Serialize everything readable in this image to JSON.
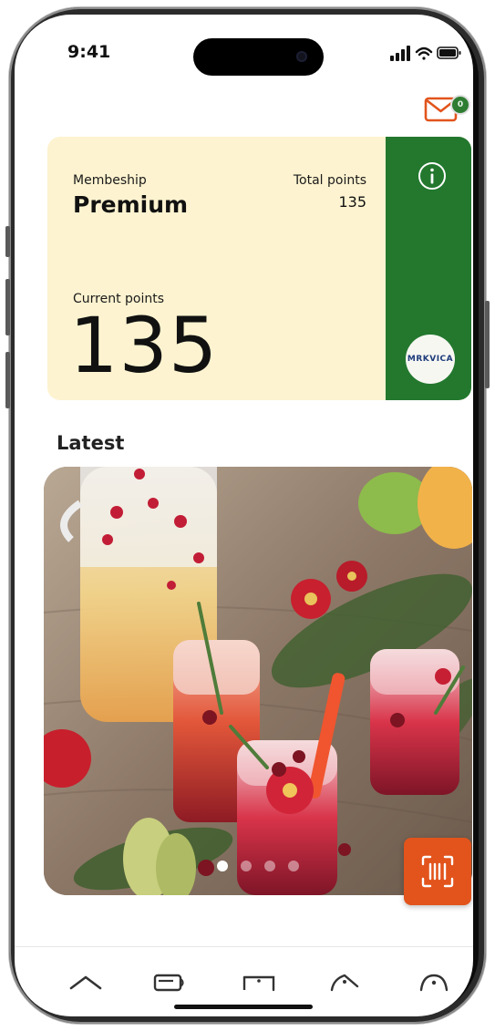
{
  "status_bar": {
    "time": "9:41"
  },
  "mail": {
    "badge": "0"
  },
  "card": {
    "membership_label": "Membeship",
    "membership_value": "Premium",
    "total_points_label": "Total points",
    "total_points_value": "135",
    "current_points_label": "Current points",
    "current_points_value": "135",
    "brand_logo_text": "MRKVICA"
  },
  "latest": {
    "title": "Latest",
    "carousel_page_count": 4,
    "carousel_active_index": 0
  },
  "nav": {
    "items": [
      "home-icon",
      "card-icon",
      "ticket-icon",
      "tag-icon",
      "profile-icon"
    ]
  },
  "colors": {
    "card_background": "#fdf3d0",
    "card_accent": "#23782e",
    "action_orange": "#e2541c",
    "mail_icon": "#e2541c"
  }
}
